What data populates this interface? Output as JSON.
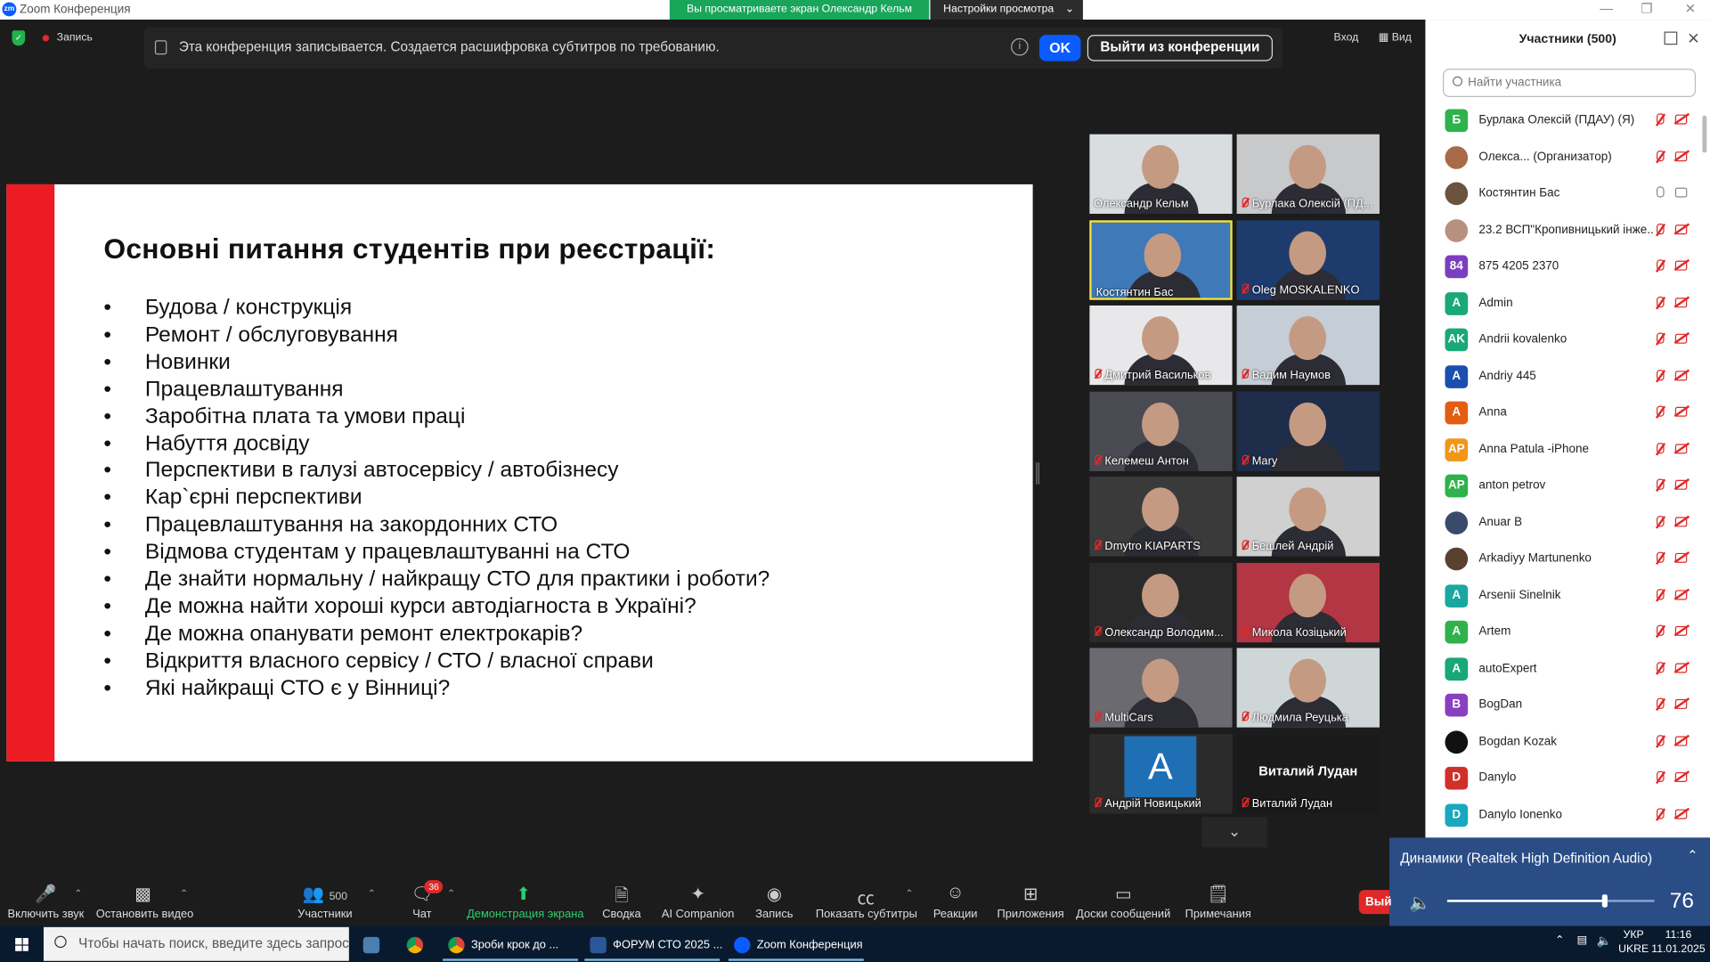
{
  "window": {
    "title": "Zoom Конференция"
  },
  "top_bar": {
    "viewing": "Вы просматриваете экран Олександр Кельм",
    "view_settings": "Настройки просмотра",
    "record": "Запись",
    "enter": "Вход",
    "view": "Вид"
  },
  "banner": {
    "message": "Эта конференция записывается. Создается расшифровка субтитров по требованию.",
    "ok": "OK",
    "leave": "Выйти из конференции"
  },
  "slide": {
    "title": "Основні питання студентів при реєстрації:",
    "items": [
      "Будова / конструкція",
      "Ремонт / обслуговування",
      "Новинки",
      "Працевлаштування",
      "Заробітна плата та умови праці",
      "Набуття досвіду",
      "Перспективи в галузі автосервісу / автобізнесу",
      "Кар`єрні перспективи",
      "Працевлаштування на закордонних СТО",
      "Відмова студентам у працевлаштуванні на СТО",
      "Де знайти нормальну / найкращу СТО для практики і роботи?",
      "Де можна найти хороші курси автодіагноста в Україні?",
      "Де можна опанувати ремонт електрокарів?",
      "Відкриття власного сервісу / СТО / власної справи",
      "Які найкращі СТО є у Вінниці?"
    ]
  },
  "video_tiles": [
    {
      "name": "Олександр Кельм",
      "muted": false,
      "color": "#d9dde0"
    },
    {
      "name": "Бурлака Олексій (ПД...",
      "muted": true,
      "color": "#c7c9cb"
    },
    {
      "name": "Костянтин Бас",
      "muted": false,
      "color": "#3f79b8"
    },
    {
      "name": "Oleg MOSKALENKO",
      "muted": true,
      "color": "#1e3b6e"
    },
    {
      "name": "Дмитрий Васильков",
      "muted": true,
      "color": "#e8e8ea"
    },
    {
      "name": "Вадим Наумов",
      "muted": true,
      "color": "#c5cdd6"
    },
    {
      "name": "Келемеш Антон",
      "muted": true,
      "color": "#4a4a52"
    },
    {
      "name": "Mary",
      "muted": true,
      "color": "#1d2d4a"
    },
    {
      "name": "Dmytro KIAPARTS",
      "muted": true,
      "color": "#3a3a3a"
    },
    {
      "name": "Бешлей Андрій",
      "muted": true,
      "color": "#cfd0cf"
    },
    {
      "name": "Олександр Володим...",
      "muted": true,
      "color": "#2a2a2a"
    },
    {
      "name": "Микола Козіцький",
      "muted": true,
      "color": "#b33644"
    },
    {
      "name": "MultiCars",
      "muted": true,
      "color": "#6a6a70"
    },
    {
      "name": "Людмила Реуцька",
      "muted": true,
      "color": "#cfd6d8"
    },
    {
      "name": "Андрій Новицький",
      "muted": true,
      "color": "#1f6fb5",
      "avatar_letter": "A"
    },
    {
      "name": "Виталий Лудан",
      "muted": true,
      "color": "#1a1a1a",
      "big_label": "Виталий Лудан"
    }
  ],
  "participants": {
    "title": "Участники (500)",
    "search_placeholder": "Найти участника",
    "list": [
      {
        "initials": "Б",
        "color": "#2fb24c",
        "name": "Бурлака Олексій (ПДАУ) (Я)",
        "mic": "off",
        "cam": "off"
      },
      {
        "initials": "",
        "color": "#a86b4a",
        "name": "Олекса... (Организатор)",
        "mic": "off",
        "cam": "off",
        "photo": true
      },
      {
        "initials": "",
        "color": "#6a5440",
        "name": "Костянтин Бас",
        "mic": "on",
        "cam": "on",
        "photo": true
      },
      {
        "initials": "",
        "color": "#b89080",
        "name": "23.2 ВСП\"Кропивницький інже...",
        "mic": "off",
        "cam": "off",
        "photo": true
      },
      {
        "initials": "84",
        "color": "#7a3fc0",
        "name": "875 4205 2370",
        "mic": "off",
        "cam": "off"
      },
      {
        "initials": "A",
        "color": "#1aa77a",
        "name": "Admin",
        "mic": "off",
        "cam": "off"
      },
      {
        "initials": "AK",
        "color": "#1aa77a",
        "name": "Andrii kovalenko",
        "mic": "off",
        "cam": "off"
      },
      {
        "initials": "A",
        "color": "#1a4fb0",
        "name": "Andriy 445",
        "mic": "off",
        "cam": "off"
      },
      {
        "initials": "A",
        "color": "#e35d12",
        "name": "Anna",
        "mic": "off",
        "cam": "off"
      },
      {
        "initials": "AP",
        "color": "#f0961a",
        "name": "Anna Patula -iPhone",
        "mic": "off",
        "cam": "off"
      },
      {
        "initials": "AP",
        "color": "#2fb24c",
        "name": "anton petrov",
        "mic": "off",
        "cam": "off"
      },
      {
        "initials": "",
        "color": "#3a4a6a",
        "name": "Anuar B",
        "mic": "off",
        "cam": "off",
        "photo": true
      },
      {
        "initials": "",
        "color": "#5a4030",
        "name": "Arkadiyy Martunenko",
        "mic": "off",
        "cam": "off",
        "photo": true
      },
      {
        "initials": "A",
        "color": "#1aa7a0",
        "name": "Arsenii Sinelnik",
        "mic": "off",
        "cam": "off"
      },
      {
        "initials": "A",
        "color": "#2fb24c",
        "name": "Artem",
        "mic": "off",
        "cam": "off"
      },
      {
        "initials": "A",
        "color": "#1aa77a",
        "name": "autoExpert",
        "mic": "off",
        "cam": "off"
      },
      {
        "initials": "B",
        "color": "#8a3fc0",
        "name": "BogDan",
        "mic": "off",
        "cam": "off"
      },
      {
        "initials": "",
        "color": "#111",
        "name": "Bogdan Kozak",
        "mic": "off",
        "cam": "off",
        "photo": true
      },
      {
        "initials": "D",
        "color": "#d0302a",
        "name": "Danylo",
        "mic": "off",
        "cam": "off"
      },
      {
        "initials": "D",
        "color": "#1aa7c0",
        "name": "Danylo Ionenko",
        "mic": "off",
        "cam": "off"
      }
    ]
  },
  "audio": {
    "device": "Динамики (Realtek High Definition Audio)",
    "volume": "76",
    "volume_fraction": 0.76
  },
  "toolbar": {
    "unmute": "Включить звук",
    "stop_video": "Остановить видео",
    "participants": "Участники",
    "participants_count": "500",
    "chat": "Чат",
    "chat_badge": "36",
    "share": "Демонстрация экрана",
    "summary": "Сводка",
    "ai": "AI Companion",
    "record": "Запись",
    "captions": "Показать субтитры",
    "reactions": "Реакции",
    "apps": "Приложения",
    "whiteboards": "Доски сообщений",
    "notes": "Примечания",
    "end": "Вый"
  },
  "taskbar": {
    "search": "Чтобы начать поиск, введите здесь запрос",
    "app1": "Зроби крок до ...",
    "app2": "ФОРУМ СТО 2025 ...",
    "app3": "Zoom Конференция",
    "lang1": "УКР",
    "lang2": "UKRE",
    "time": "11:16",
    "date": "11.01.2025"
  }
}
